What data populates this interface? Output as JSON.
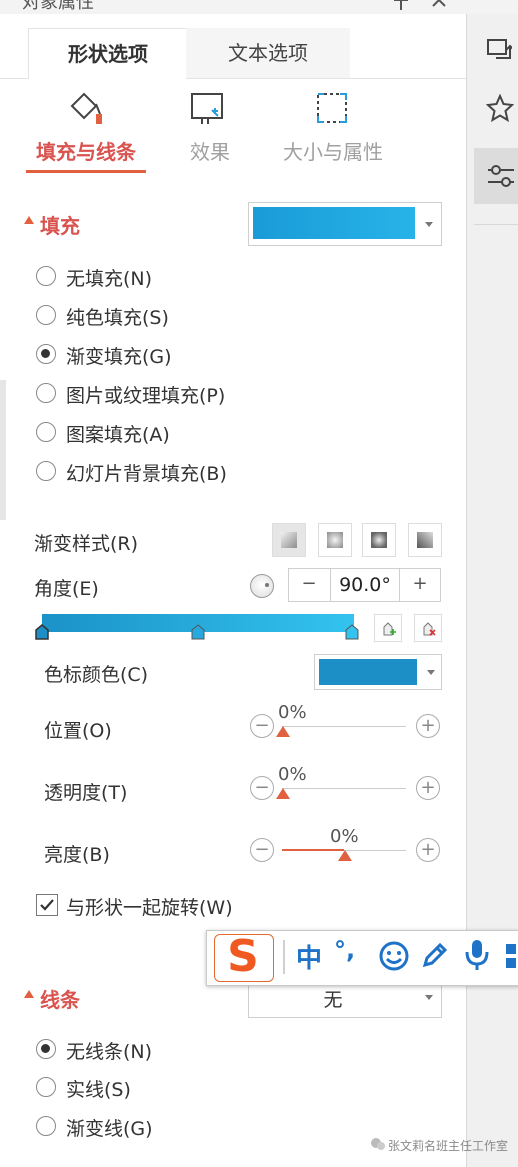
{
  "window": {
    "title": "对象属性"
  },
  "tabs": [
    {
      "label": "形状选项",
      "active": true
    },
    {
      "label": "文本选项",
      "active": false
    }
  ],
  "subtabs": [
    {
      "label": "填充与线条",
      "icon": "fill-bucket-icon",
      "active": true
    },
    {
      "label": "效果",
      "icon": "effects-icon",
      "active": false
    },
    {
      "label": "大小与属性",
      "icon": "size-icon",
      "active": false
    }
  ],
  "fill": {
    "title": "填充",
    "swatch_colors": [
      "#1a9bd7",
      "#27b3e8"
    ],
    "options": [
      {
        "label": "无填充(N)",
        "checked": false
      },
      {
        "label": "纯色填充(S)",
        "checked": false
      },
      {
        "label": "渐变填充(G)",
        "checked": true
      },
      {
        "label": "图片或纹理填充(P)",
        "checked": false
      },
      {
        "label": "图案填充(A)",
        "checked": false
      },
      {
        "label": "幻灯片背景填充(B)",
        "checked": false
      }
    ],
    "gradient_style_label": "渐变样式(R)",
    "angle_label": "角度(E)",
    "angle_value": "90.0°",
    "stop_color_label": "色标颜色(C)",
    "stop_color": "#1b8fc6",
    "position": {
      "label": "位置(O)",
      "value": "0%",
      "level": 0
    },
    "transparency": {
      "label": "透明度(T)",
      "value": "0%",
      "level": 0
    },
    "brightness": {
      "label": "亮度(B)",
      "value": "0%",
      "level": 0.5
    },
    "rotate_label": "与形状一起旋转(W)",
    "rotate_checked": true
  },
  "line": {
    "title": "线条",
    "dropdown_value": "无",
    "options": [
      {
        "label": "无线条(N)",
        "checked": true
      },
      {
        "label": "实线(S)",
        "checked": false
      },
      {
        "label": "渐变线(G)",
        "checked": false
      }
    ]
  },
  "spin": {
    "minus": "−",
    "plus": "+"
  },
  "slider_minus": "−",
  "slider_plus": "+",
  "ime": {
    "chinese": "中",
    "punct": "°,",
    "logo": "S"
  },
  "watermark": "张文莉名班主任工作室",
  "accent": "#e0603f"
}
